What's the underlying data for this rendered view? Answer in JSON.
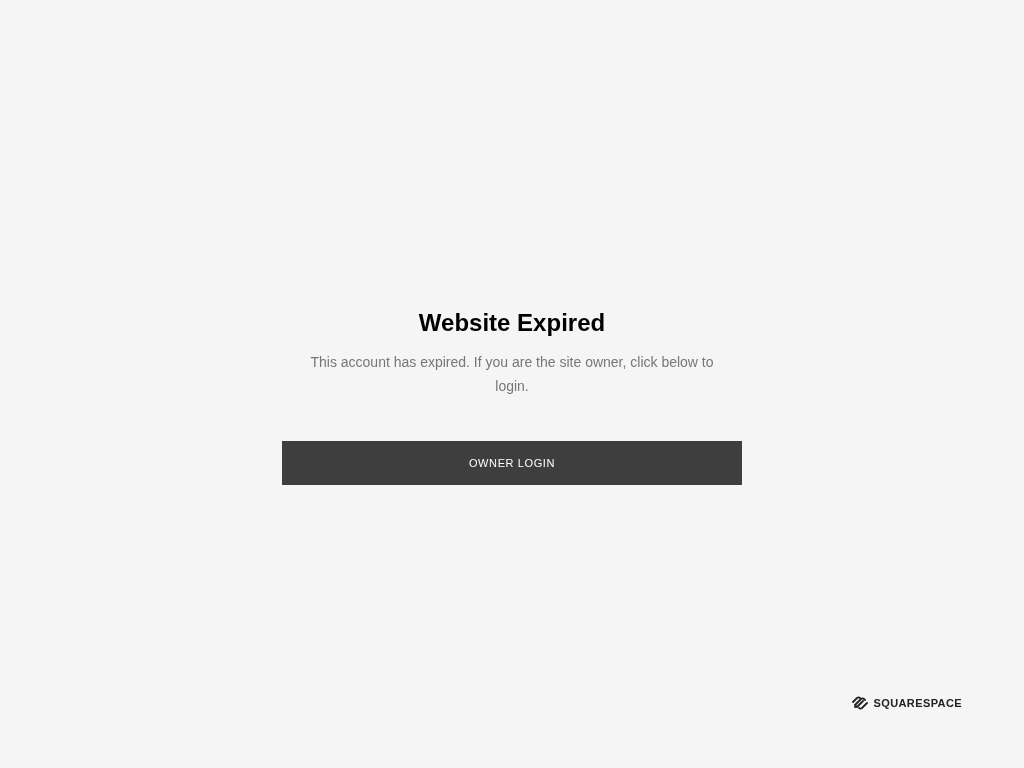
{
  "title": "Website Expired",
  "message": "This account has expired. If you are the site owner, click below to login.",
  "button": "OWNER LOGIN",
  "footer": {
    "brand": "SQUARESPACE"
  }
}
